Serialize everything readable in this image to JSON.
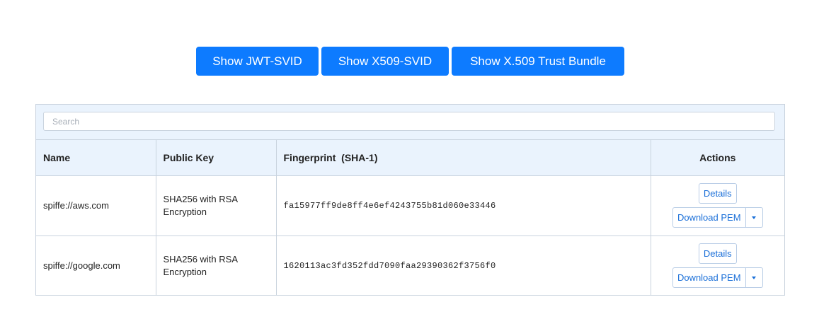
{
  "toolbar": {
    "show_jwt_label": "Show JWT-SVID",
    "show_x509_label": "Show X509-SVID",
    "show_bundle_label": "Show X.509 Trust Bundle"
  },
  "search": {
    "placeholder": "Search",
    "value": ""
  },
  "table": {
    "columns": [
      "Name",
      "Public Key",
      "Fingerprint  (SHA-1)",
      "Actions"
    ],
    "rows": [
      {
        "name": "spiffe://aws.com",
        "public_key": "SHA256 with RSA Encryption",
        "fingerprint": "fa15977ff9de8ff4e6ef4243755b81d060e33446",
        "details_label": "Details",
        "download_label": "Download PEM"
      },
      {
        "name": "spiffe://google.com",
        "public_key": "SHA256 with RSA Encryption",
        "fingerprint": "1620113ac3fd352fdd7090faa29390362f3756f0",
        "details_label": "Details",
        "download_label": "Download PEM"
      }
    ]
  },
  "icons": {
    "dropdown": "caret-down-icon"
  },
  "colors": {
    "primary": "#0d7bff",
    "header_bg": "#eaf3fd",
    "border": "#c9d3de",
    "link": "#1a6fd8"
  }
}
